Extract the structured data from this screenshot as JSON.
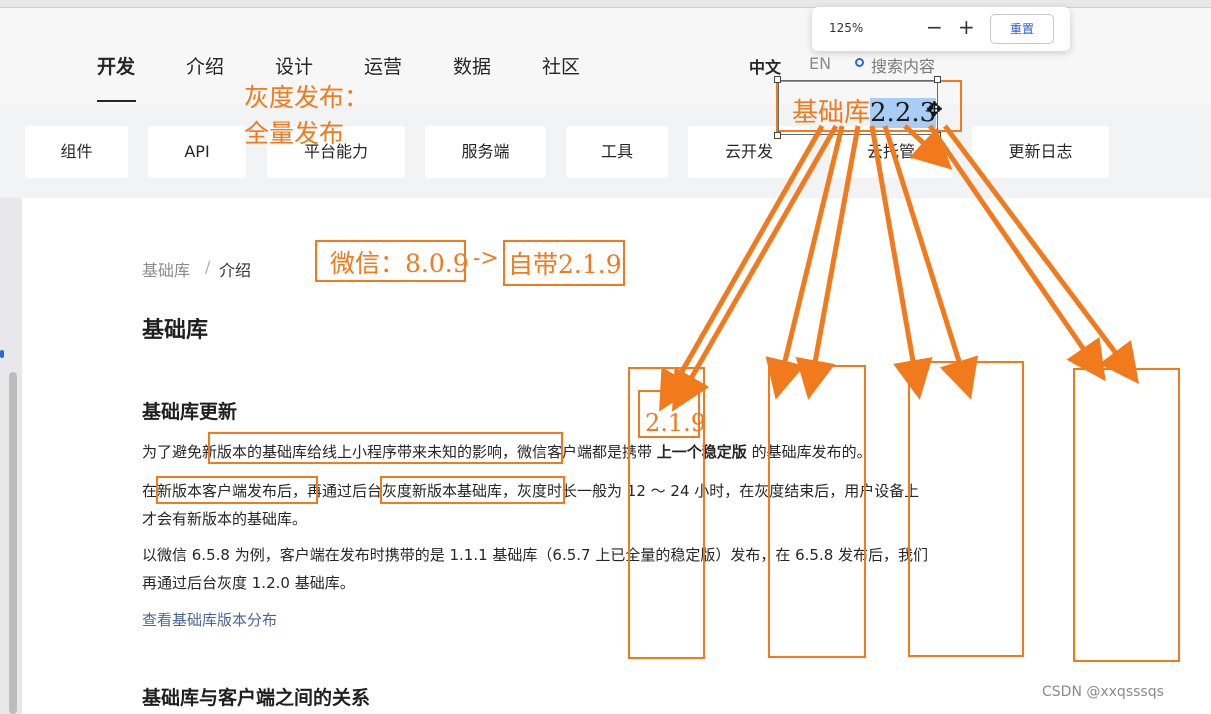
{
  "topnav": {
    "items": [
      "开发",
      "介绍",
      "设计",
      "运营",
      "数据",
      "社区"
    ],
    "active": "开发",
    "lang_zh": "中文",
    "lang_en": "EN",
    "search_placeholder": "搜索内容"
  },
  "zoom": {
    "value": "125%",
    "minus": "−",
    "plus": "+",
    "reset": "重置"
  },
  "subnav": [
    "组件",
    "API",
    "平台能力",
    "服务端",
    "工具",
    "云开发",
    "云托管",
    "更新日志"
  ],
  "breadcrumb": {
    "base": "基础库",
    "sep": "/",
    "current": "介绍"
  },
  "article": {
    "title": "基础库",
    "section1": "基础库更新",
    "p1a": "为了避免新版本的基础库给线上小程序带来未知的影响，微信客户端都是携带 ",
    "p1b": "上一个稳定版",
    "p1c": " 的基础库发布的。",
    "p2a": "在新版本客户端发布后，再通过后台灰度新版本基础库，灰度时长一般为 12 ～ 24 小时，在灰度结束后，用户设备上",
    "p2b": "才会有新版本的基础库。",
    "p3a": "以微信 6.5.8 为例，客户端在发布时携带的是 1.1.1 基础库（6.5.7 上已全量的稳定版）发布，在 6.5.8 发布后，我们",
    "p3b": "再通过后台灰度 1.2.0 基础库。",
    "link": "查看基础库版本分布",
    "section2": "基础库与客户端之间的关系"
  },
  "annotations": {
    "gray_line1": "灰度发布：",
    "gray_line2": "全量发布",
    "lib_label": "基础库",
    "lib_version": "2.2.3",
    "wechat": "微信：8.0.9",
    "arrow": "->",
    "builtin": "自带2.1.9",
    "small_version": "2.1.9"
  },
  "watermark": "CSDN @xxqsssqs",
  "colors": {
    "annotation": "#f07a1c",
    "selection": "#a9cdf5",
    "link": "#4a6699"
  }
}
